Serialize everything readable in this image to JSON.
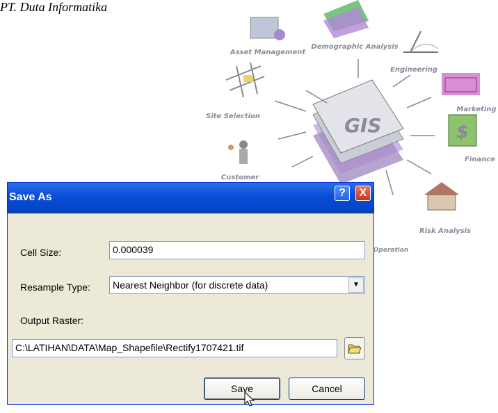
{
  "header": {
    "text": "PT. Duta Informatika"
  },
  "graphic": {
    "labels": {
      "asset": "Asset Management",
      "demographic": "Demographic Analysis",
      "engineering": "Engineering",
      "marketing": "Marketing",
      "finance": "Finance",
      "site": "Site Selection",
      "customer": "Customer",
      "gis": "GIS",
      "risk": "Risk Analysis",
      "operation": "Operation"
    }
  },
  "dialog": {
    "title": "Save As",
    "help_glyph": "?",
    "close_glyph": "X",
    "cell_size_label": "Cell Size:",
    "cell_size_value": "0.000039",
    "resample_label": "Resample Type:",
    "resample_value": "Nearest Neighbor (for discrete data)",
    "output_label": "Output Raster:",
    "output_value": "C:\\LATIHAN\\DATA\\Map_Shapefile\\Rectify1707421.tif",
    "save_label": "Save",
    "cancel_label": "Cancel"
  },
  "colors": {
    "titlebar": "#0a4fd6",
    "dialog_bg": "#ece9d8",
    "field_border": "#7f9db9"
  }
}
